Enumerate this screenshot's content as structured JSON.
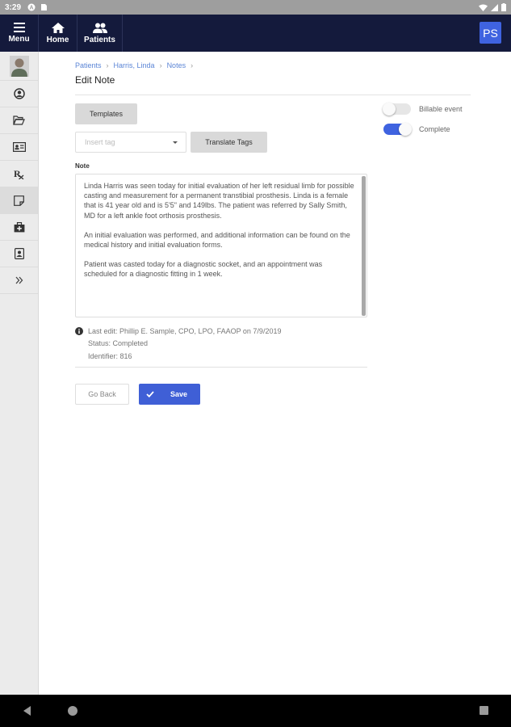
{
  "status_bar": {
    "time": "3:29"
  },
  "topnav": {
    "menu_label": "Menu",
    "home_label": "Home",
    "patients_label": "Patients",
    "user_initials": "PS"
  },
  "breadcrumb": [
    "Patients",
    "Harris, Linda",
    "Notes"
  ],
  "page": {
    "title": "Edit Note"
  },
  "toolbar": {
    "templates_label": "Templates",
    "insert_tag_placeholder": "Insert tag",
    "translate_tags_label": "Translate Tags"
  },
  "note": {
    "label": "Note",
    "paragraphs": [
      "Linda Harris was seen today for initial evaluation of her left residual limb for possible casting and measurement for a permanent transtibial prosthesis. Linda is a female that is 41 year old and is 5'5\" and 149lbs.  The patient was referred by Sally Smith, MD for a left ankle foot orthosis prosthesis.",
      "An initial evaluation was performed, and additional information  can be found on the medical history and initial evaluation forms.",
      "Patient was casted today for a diagnostic socket, and an appointment was scheduled for a diagnostic fitting in 1 week."
    ]
  },
  "meta": {
    "last_edit": "Last edit: Phillip E. Sample, CPO, LPO, FAAOP on 7/9/2019",
    "status": "Status: Completed",
    "identifier": "Identifier: 816"
  },
  "actions": {
    "go_back_label": "Go Back",
    "save_label": "Save"
  },
  "toggles": [
    {
      "label": "Billable event",
      "on": false
    },
    {
      "label": "Complete",
      "on": true
    }
  ],
  "colors": {
    "nav_bg": "#141a3c",
    "accent": "#3f63e0",
    "link": "#5b85d6"
  }
}
